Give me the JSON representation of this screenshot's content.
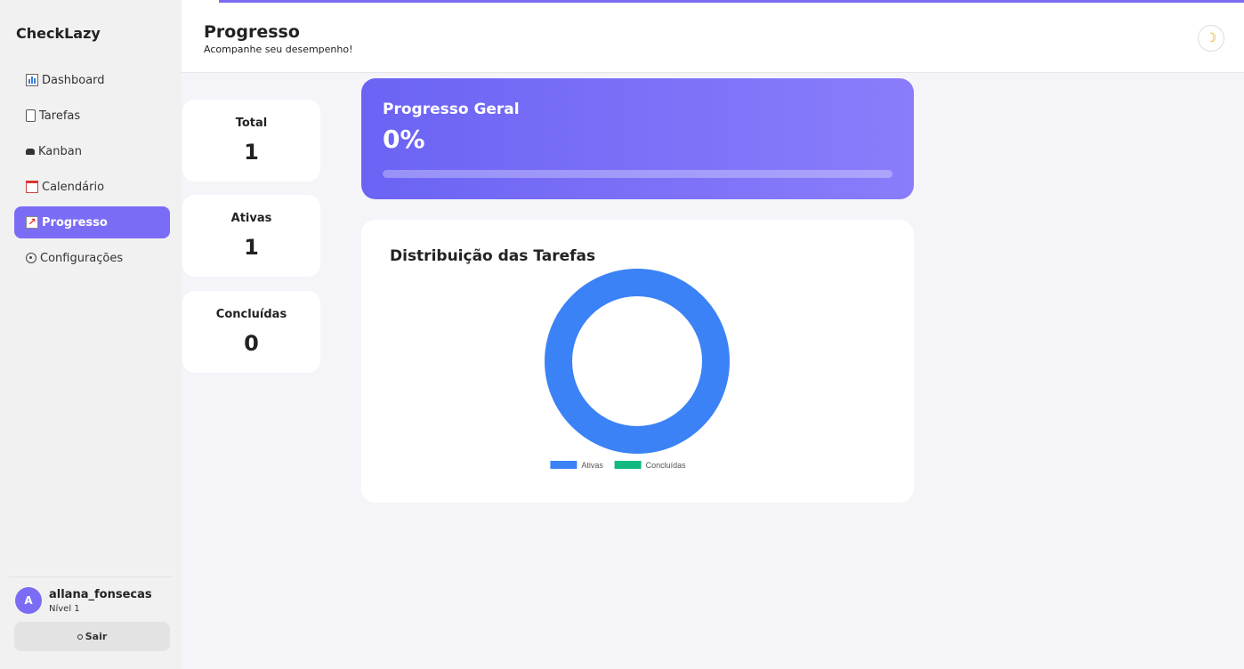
{
  "app": {
    "name": "CheckLazy"
  },
  "sidebar": {
    "items": [
      {
        "label": "Dashboard",
        "icon": "bar-chart-icon",
        "active": false
      },
      {
        "label": "Tarefas",
        "icon": "clipboard-icon",
        "active": false
      },
      {
        "label": "Kanban",
        "icon": "kanban-icon",
        "active": false
      },
      {
        "label": "Calendário",
        "icon": "calendar-icon",
        "active": false
      },
      {
        "label": "Progresso",
        "icon": "trend-chart-icon",
        "active": true
      },
      {
        "label": "Configurações",
        "icon": "gear-icon",
        "active": false
      }
    ],
    "user": {
      "initial": "A",
      "name": "allana_fonsecas",
      "level": "Nível 1"
    },
    "logout_label": "Sair"
  },
  "header": {
    "title": "Progresso",
    "subtitle": "Acompanhe seu desempenho!",
    "theme_icon": "moon-icon"
  },
  "stats": [
    {
      "label": "Total",
      "value": "1"
    },
    {
      "label": "Ativas",
      "value": "1"
    },
    {
      "label": "Concluídas",
      "value": "0"
    }
  ],
  "progress": {
    "title": "Progresso Geral",
    "percent_text": "0%",
    "fraction": 0
  },
  "chart_data": {
    "type": "pie",
    "title": "Distribuição das Tarefas",
    "categories": [
      "Ativas",
      "Concluídas"
    ],
    "values": [
      1,
      0
    ],
    "colors": [
      "#3b82f6",
      "#10b981"
    ],
    "legend": "bottom"
  },
  "colors": {
    "accent": "#7b6cf5",
    "background": "#f5f5f9"
  }
}
